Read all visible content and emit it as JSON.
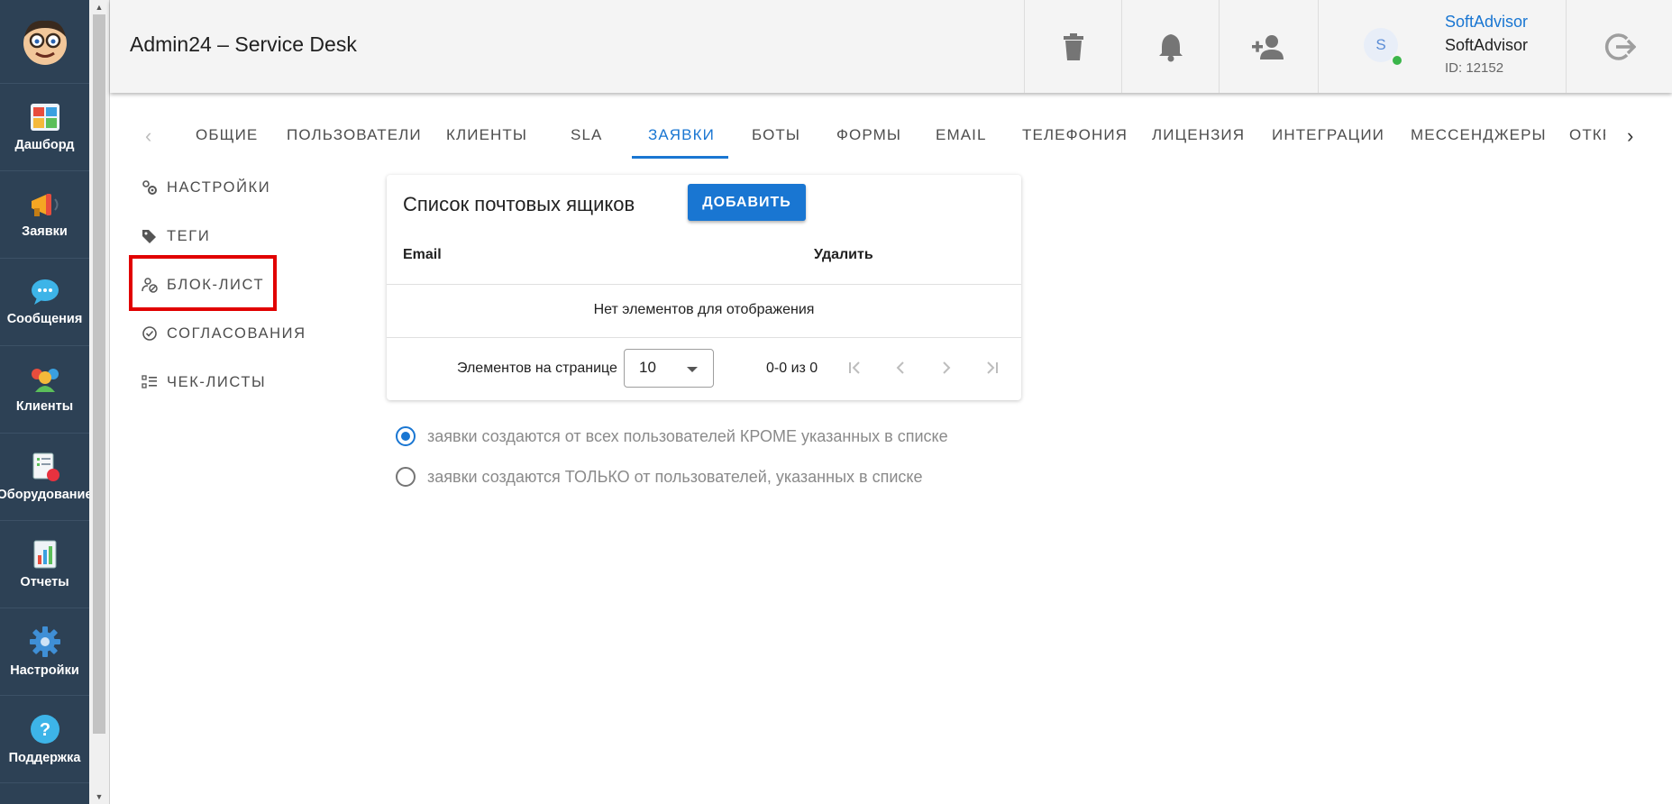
{
  "app": {
    "title": "Admin24 – Service Desk"
  },
  "rail": {
    "items": [
      {
        "label": "Дашборд",
        "icon": "dashboard-icon"
      },
      {
        "label": "Заявки",
        "icon": "megaphone-icon"
      },
      {
        "label": "Сообщения",
        "icon": "chat-bubble-icon"
      },
      {
        "label": "Клиенты",
        "icon": "clients-icon"
      },
      {
        "label": "Оборудование",
        "icon": "equipment-icon"
      },
      {
        "label": "Отчеты",
        "icon": "reports-icon"
      },
      {
        "label": "Настройки",
        "icon": "gear-icon"
      },
      {
        "label": "Поддержка",
        "icon": "help-icon"
      }
    ]
  },
  "topbar": {
    "actions": [
      "trash-icon",
      "bell-icon",
      "add-person-icon",
      "logout-icon"
    ],
    "user": {
      "avatar_letter": "S",
      "link": "SoftAdvisor",
      "name": "SoftAdvisor",
      "id": "ID: 12152"
    }
  },
  "tabs": [
    "ОБЩИЕ",
    "ПОЛЬЗОВАТЕЛИ",
    "КЛИЕНТЫ",
    "SLA",
    "ЗАЯВКИ",
    "БОТЫ",
    "ФОРМЫ",
    "EMAIL",
    "ТЕЛЕФОНИЯ",
    "ЛИЦЕНЗИЯ",
    "ИНТЕГРАЦИИ",
    "МЕССЕНДЖЕРЫ",
    "ОТКР"
  ],
  "active_tab": "ЗАЯВКИ",
  "side_menu": [
    "НАСТРОЙКИ",
    "ТЕГИ",
    "БЛОК-ЛИСТ",
    "СОГЛАСОВАНИЯ",
    "ЧЕК-ЛИСТЫ"
  ],
  "highlighted_menu_item": "БЛОК-ЛИСТ",
  "card": {
    "title": "Список почтовых ящиков",
    "add_label": "ДОБАВИТЬ",
    "columns": [
      "Email",
      "Удалить"
    ],
    "empty_text": "Нет элементов для отображения",
    "pagination": {
      "per_page_label": "Элементов на странице",
      "per_page_value": "10",
      "range": "0-0 из 0"
    }
  },
  "mode_options": [
    {
      "label": "заявки создаются от всех пользователей КРОМЕ указанных в списке",
      "selected": true
    },
    {
      "label": "заявки создаются ТОЛЬКО от пользователей, указанных в списке",
      "selected": false
    }
  ],
  "colors": {
    "accent": "#1976d2",
    "rail": "#2d4155",
    "highlight": "#e10000"
  }
}
